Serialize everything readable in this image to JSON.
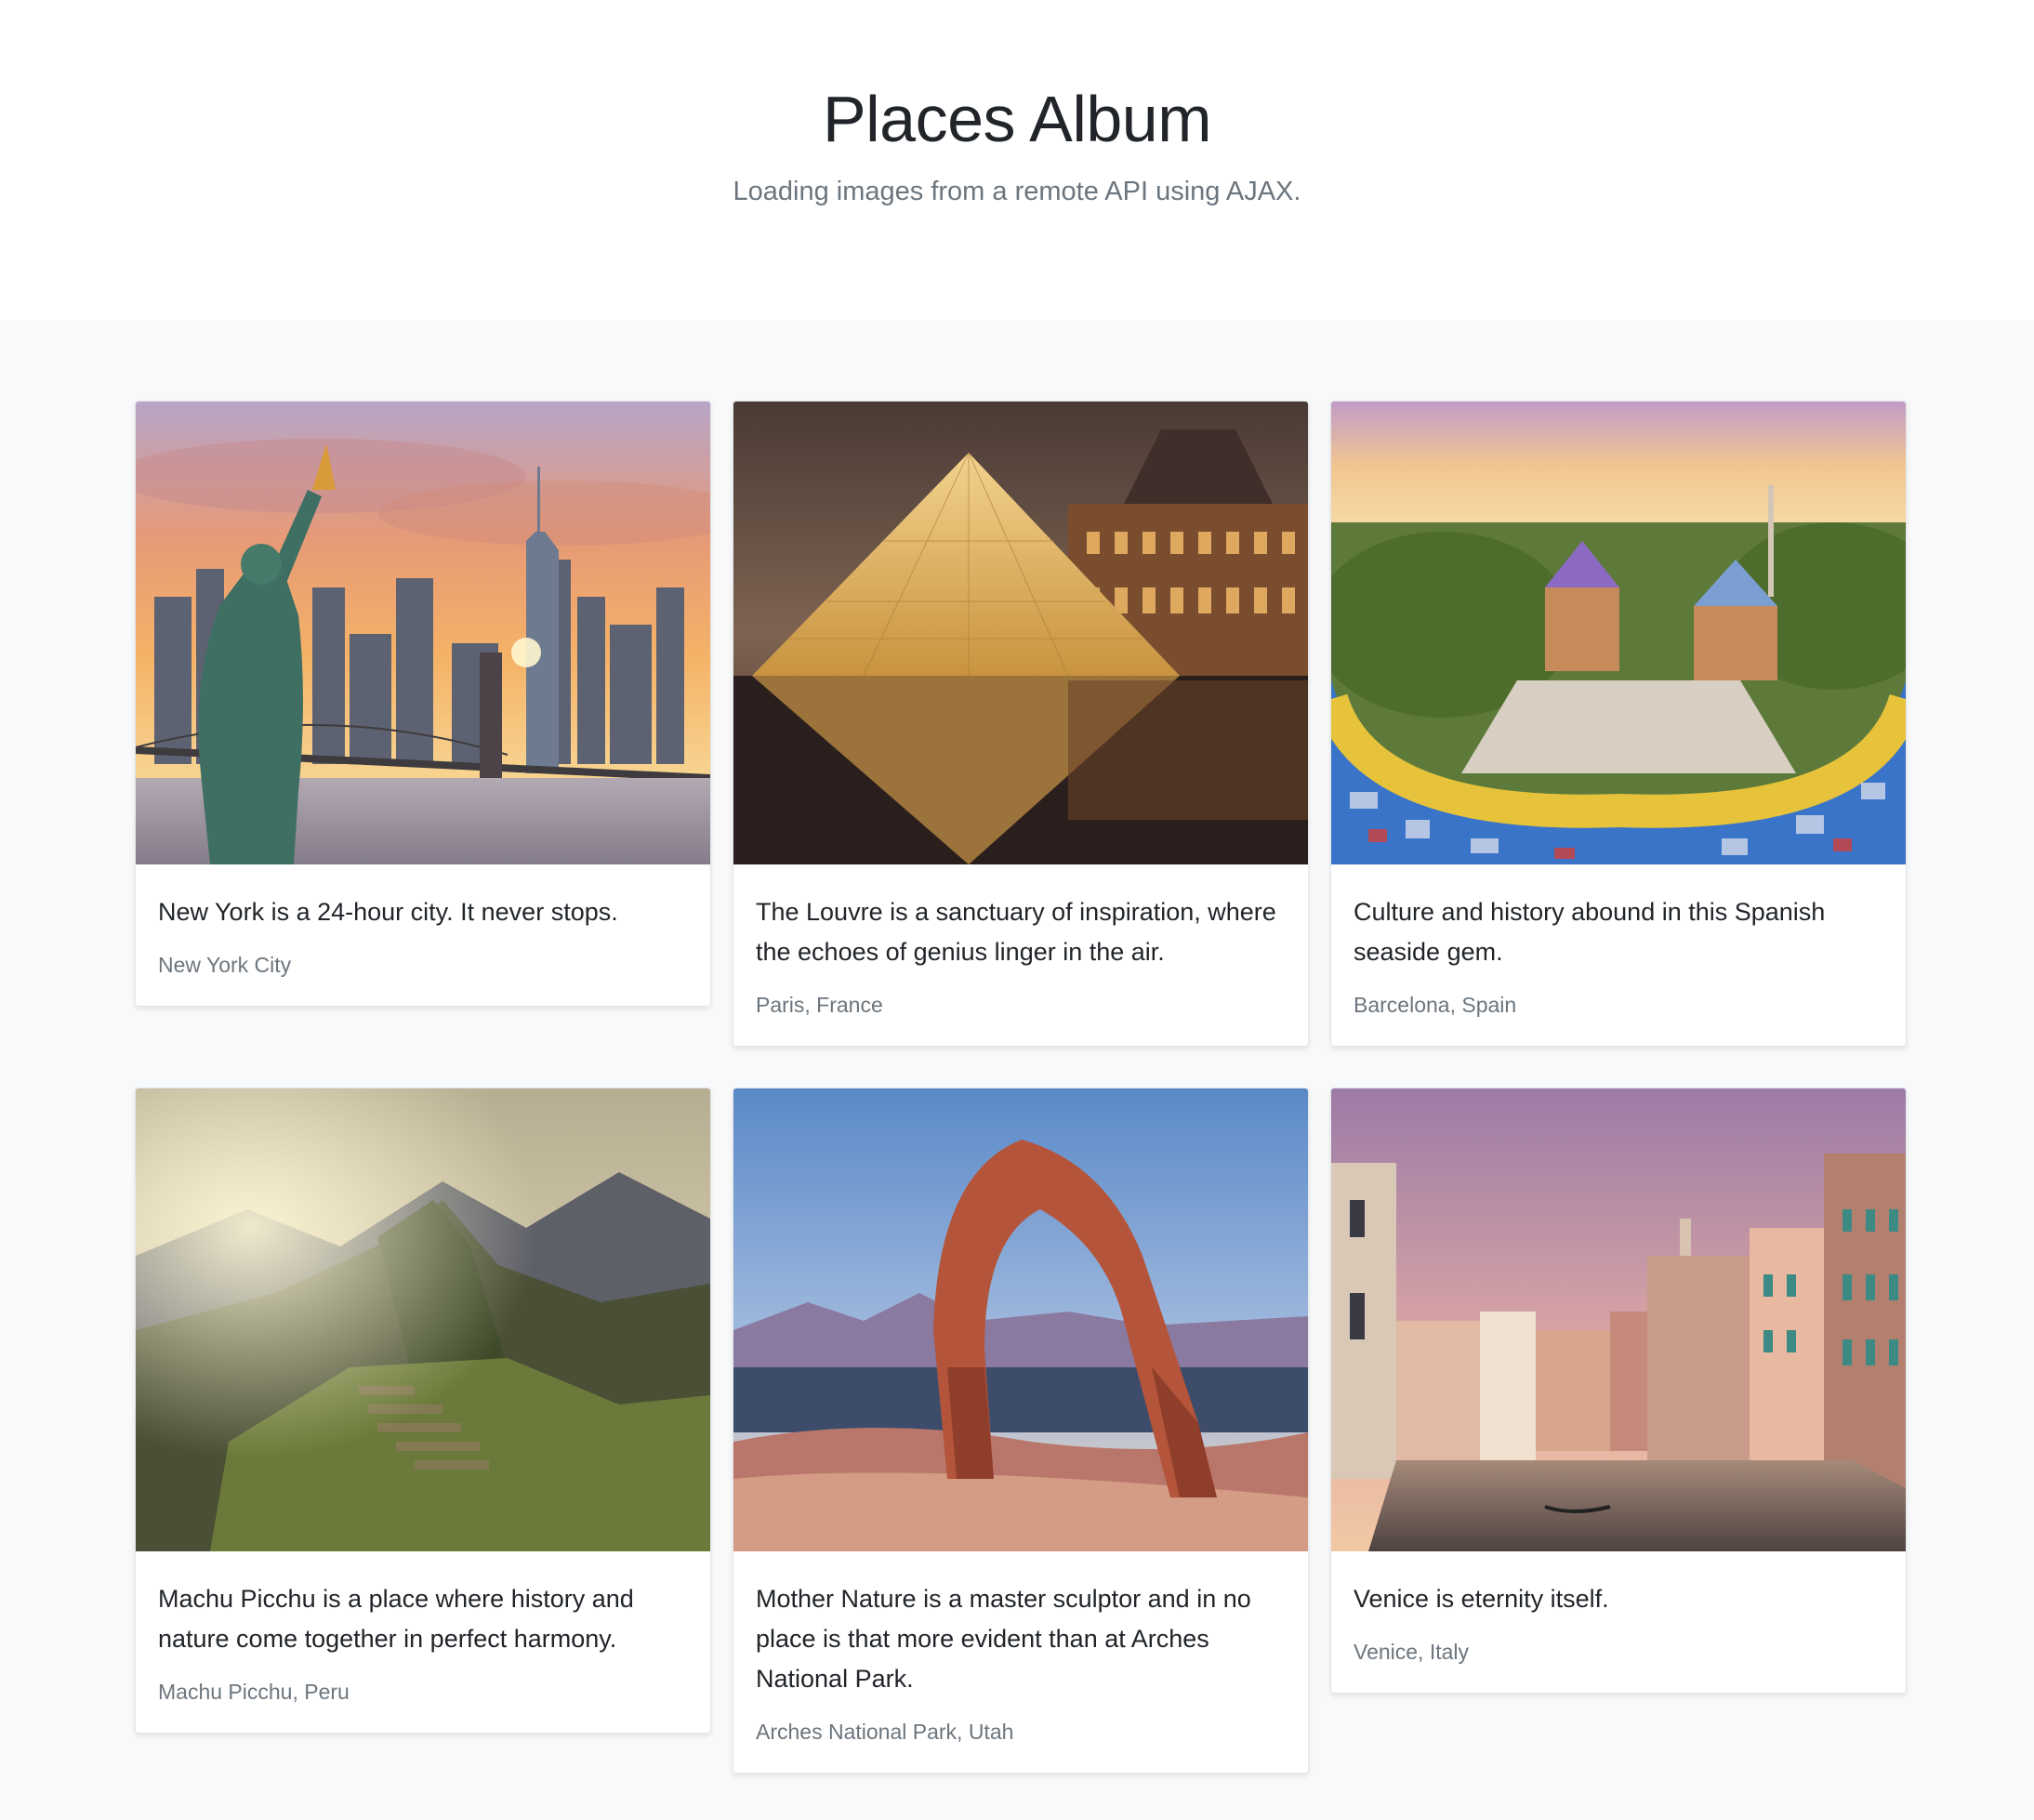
{
  "header": {
    "title": "Places Album",
    "subtitle": "Loading images from a remote API using AJAX."
  },
  "cards": [
    {
      "text": "New York is a 24-hour city. It never stops.",
      "location": "New York City",
      "image": "statue-of-liberty-skyline-photo"
    },
    {
      "text": "The Louvre is a sanctuary of inspiration, where the echoes of genius linger in the air.",
      "location": "Paris, France",
      "image": "louvre-pyramid-photo"
    },
    {
      "text": "Culture and history abound in this Spanish seaside gem.",
      "location": "Barcelona, Spain",
      "image": "park-guell-photo"
    },
    {
      "text": "Machu Picchu is a place where history and nature come together in perfect harmony.",
      "location": "Machu Picchu, Peru",
      "image": "machu-picchu-photo"
    },
    {
      "text": "Mother Nature is a master sculptor and in no place is that more evident than at Arches National Park.",
      "location": "Arches National Park, Utah",
      "image": "delicate-arch-photo"
    },
    {
      "text": "Venice is eternity itself.",
      "location": "Venice, Italy",
      "image": "venice-grand-canal-photo"
    }
  ]
}
